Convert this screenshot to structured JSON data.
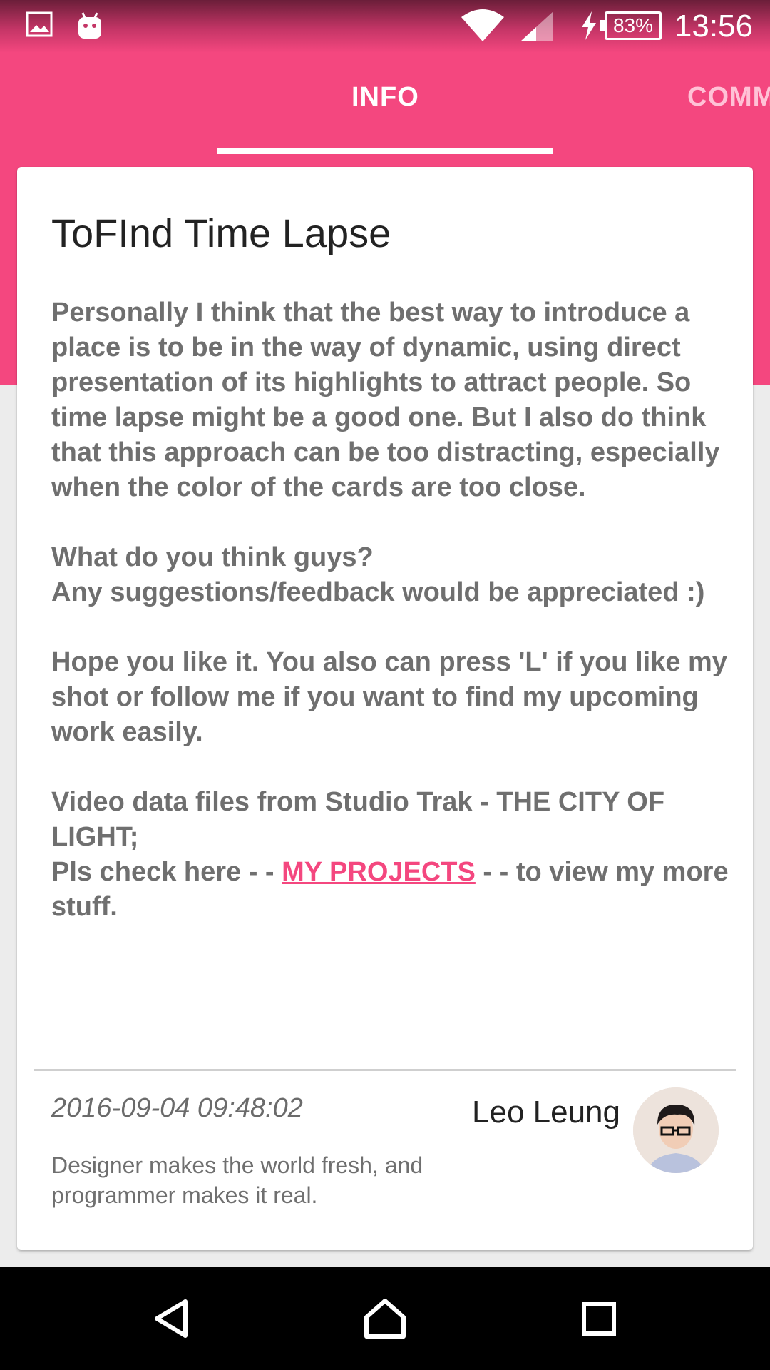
{
  "status_bar": {
    "time": "13:56",
    "battery_percent": "83%",
    "icons": [
      "photo-icon",
      "android-icon",
      "wifi-icon",
      "signal-icon",
      "charging-icon",
      "battery-icon"
    ]
  },
  "tabs": [
    {
      "label": "INFO",
      "selected": true
    },
    {
      "label": "COMM",
      "selected": false
    }
  ],
  "post": {
    "title": "ToFInd Time Lapse",
    "paragraphs": [
      "Personally I think that the best way to introduce a place is to be in the way of dynamic, using direct presentation of its highlights to attract people. So time lapse might be a good one. But I also do think that this approach can be too distracting, especially when the color of the cards are too close.",
      "What do you think guys?\nAny suggestions/feedback would be appreciated :)",
      "Hope you like it. You also can press 'L' if you like my shot or follow me if you want to find my upcoming work easily."
    ],
    "last_paragraph": {
      "line1": "Video data files from Studio Trak - THE CITY OF LIGHT;",
      "prefix": "Pls check here - - ",
      "link_text": "MY PROJECTS",
      "suffix": " - - to view my more stuff."
    },
    "timestamp": "2016-09-04 09:48:02",
    "author_name": "Leo Leung",
    "author_bio": "Designer makes the world fresh, and programmer makes it real."
  },
  "colors": {
    "accent": "#f4477f",
    "tab_inactive": "#ffc2d6",
    "title_text": "#222222",
    "body_text": "#6f6f6f",
    "nav_bar": "#000000"
  },
  "nav_bar": {
    "icons": [
      "back-icon",
      "home-icon",
      "recent-apps-icon"
    ]
  }
}
